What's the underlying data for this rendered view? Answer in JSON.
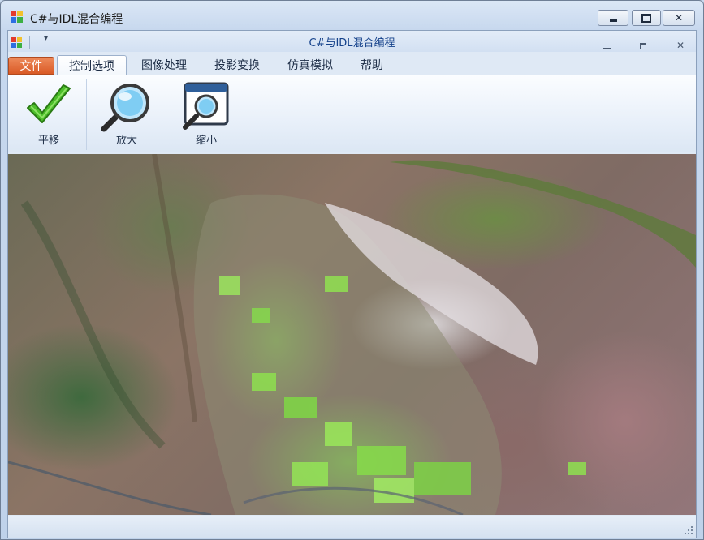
{
  "window": {
    "title": "C#与IDL混合编程",
    "controls": {
      "minimize": "minimize",
      "maximize": "maximize",
      "close": "✕"
    }
  },
  "ribbon": {
    "title": "C#与IDL混合编程",
    "quick_access_dropdown": "▾",
    "mdi_close": "✕",
    "tabs": [
      {
        "label": "文件",
        "kind": "file"
      },
      {
        "label": "控制选项",
        "active": true
      },
      {
        "label": "图像处理"
      },
      {
        "label": "投影变换"
      },
      {
        "label": "仿真模拟"
      },
      {
        "label": "帮助"
      }
    ],
    "buttons": [
      {
        "label": "平移",
        "icon": "checkmark-icon"
      },
      {
        "label": "放大",
        "icon": "magnifier-icon"
      },
      {
        "label": "缩小",
        "icon": "zoom-window-icon"
      }
    ]
  },
  "map": {
    "content": "satellite-image"
  },
  "colors": {
    "file_tab": "#d95a26",
    "ribbon_title": "#15428b",
    "frame": "#c7d8ee"
  }
}
